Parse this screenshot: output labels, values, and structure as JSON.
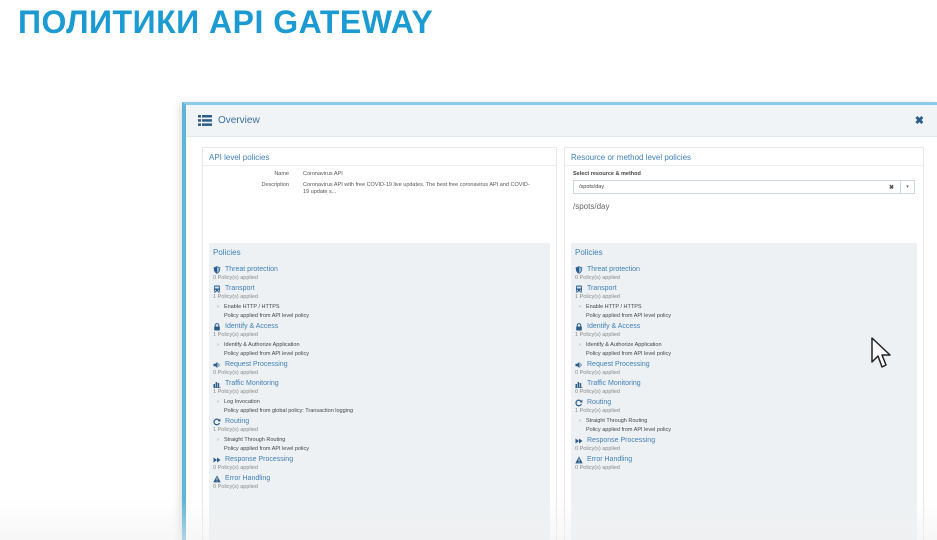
{
  "slide": {
    "title": "ПОЛИТИКИ API GATEWAY"
  },
  "window": {
    "title": "Overview",
    "close_label": "✖"
  },
  "left_panel": {
    "heading": "API level policies",
    "name_label": "Name",
    "name_value": "Coronavirus API",
    "description_label": "Description",
    "description_value": "Coronavirus API with free COVID-19 live updates. The best free coronavirus API and COVID-19 update s..."
  },
  "right_panel": {
    "heading": "Resource or method level policies",
    "select_label": "Select resource & method",
    "select_value": "/spots/day",
    "select_clear": "✖",
    "select_caret": "▾",
    "resource_path": "/spots/day"
  },
  "policies_title": "Policies",
  "left_policies": [
    {
      "icon": "shield-icon",
      "name": "Threat protection",
      "count": "0 Policy(s) applied"
    },
    {
      "icon": "bus-icon",
      "name": "Transport",
      "count": "1 Policy(s) applied",
      "item": "Enable HTTP / HTTPS",
      "note": "Policy applied from API level policy"
    },
    {
      "icon": "lock-icon",
      "name": "Identify & Access",
      "count": "1 Policy(s) applied",
      "item": "Identify & Authorize Application",
      "note": "Policy applied from API level policy"
    },
    {
      "icon": "speaker-icon",
      "name": "Request Processing",
      "count": "0 Policy(s) applied"
    },
    {
      "icon": "bar-chart-icon",
      "name": "Traffic Monitoring",
      "count": "1 Policy(s) applied",
      "item": "Log Invocation",
      "note": "Policy applied from global policy: Transaction logging"
    },
    {
      "icon": "refresh-icon",
      "name": "Routing",
      "count": "1 Policy(s) applied",
      "item": "Straight Through Routing",
      "note": "Policy applied from API level policy"
    },
    {
      "icon": "forward-icon",
      "name": "Response Processing",
      "count": "0 Policy(s) applied"
    },
    {
      "icon": "warning-icon",
      "name": "Error Handling",
      "count": "0 Policy(s) applied"
    }
  ],
  "right_policies": [
    {
      "icon": "shield-icon",
      "name": "Threat protection",
      "count": "0 Policy(s) applied"
    },
    {
      "icon": "bus-icon",
      "name": "Transport",
      "count": "1 Policy(s) applied",
      "item": "Enable HTTP / HTTPS",
      "note": "Policy applied from API level policy"
    },
    {
      "icon": "lock-icon",
      "name": "Identify & Access",
      "count": "1 Policy(s) applied",
      "item": "Identify & Authorize Application",
      "note": "Policy applied from API level policy"
    },
    {
      "icon": "speaker-icon",
      "name": "Request Processing",
      "count": "0 Policy(s) applied"
    },
    {
      "icon": "bar-chart-icon",
      "name": "Traffic Monitoring",
      "count": "0 Policy(s) applied"
    },
    {
      "icon": "refresh-icon",
      "name": "Routing",
      "count": "1 Policy(s) applied",
      "item": "Straight Through Routing",
      "note": "Policy applied from API level policy"
    },
    {
      "icon": "forward-icon",
      "name": "Response Processing",
      "count": "0 Policy(s) applied"
    },
    {
      "icon": "warning-icon",
      "name": "Error Handling",
      "count": "0 Policy(s) applied"
    }
  ],
  "colors": {
    "title_blue": "#1b9bd1",
    "link_blue": "#3f7fb6",
    "policies_bg": "#eef1f3"
  }
}
